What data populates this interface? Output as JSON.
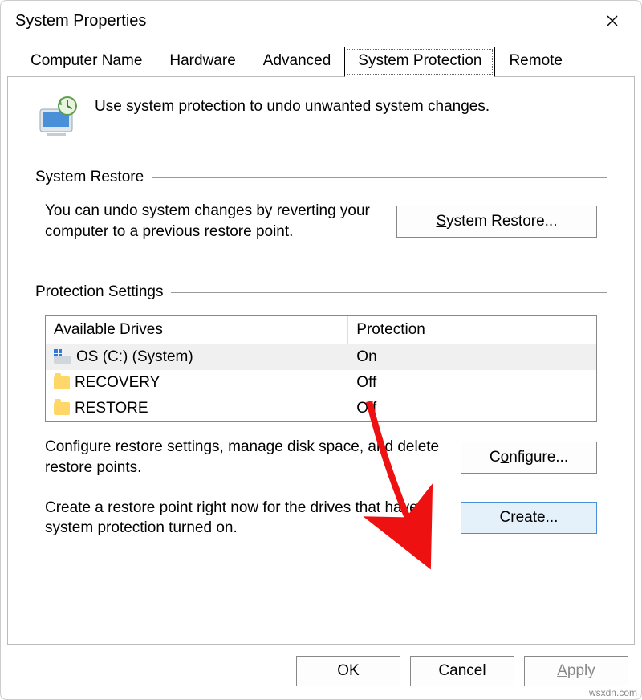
{
  "window": {
    "title": "System Properties"
  },
  "tabs": {
    "computer_name": "Computer Name",
    "hardware": "Hardware",
    "advanced": "Advanced",
    "system_protection": "System Protection",
    "remote": "Remote"
  },
  "intro": "Use system protection to undo unwanted system changes.",
  "groups": {
    "system_restore": {
      "title": "System Restore",
      "desc": "You can undo system changes by reverting your computer to a previous restore point.",
      "button": "System Restore..."
    },
    "protection_settings": {
      "title": "Protection Settings",
      "columns": {
        "drives": "Available Drives",
        "protection": "Protection"
      },
      "rows": [
        {
          "name": "OS (C:) (System)",
          "protection": "On",
          "type": "system",
          "selected": true
        },
        {
          "name": "RECOVERY",
          "protection": "Off",
          "type": "folder",
          "selected": false
        },
        {
          "name": "RESTORE",
          "protection": "Off",
          "type": "folder",
          "selected": false
        }
      ],
      "configure_desc": "Configure restore settings, manage disk space, and delete restore points.",
      "configure_button": "Configure...",
      "create_desc": "Create a restore point right now for the drives that have system protection turned on.",
      "create_button": "Create..."
    }
  },
  "footer": {
    "ok": "OK",
    "cancel": "Cancel",
    "apply": "Apply"
  },
  "watermark": "wsxdn.com"
}
